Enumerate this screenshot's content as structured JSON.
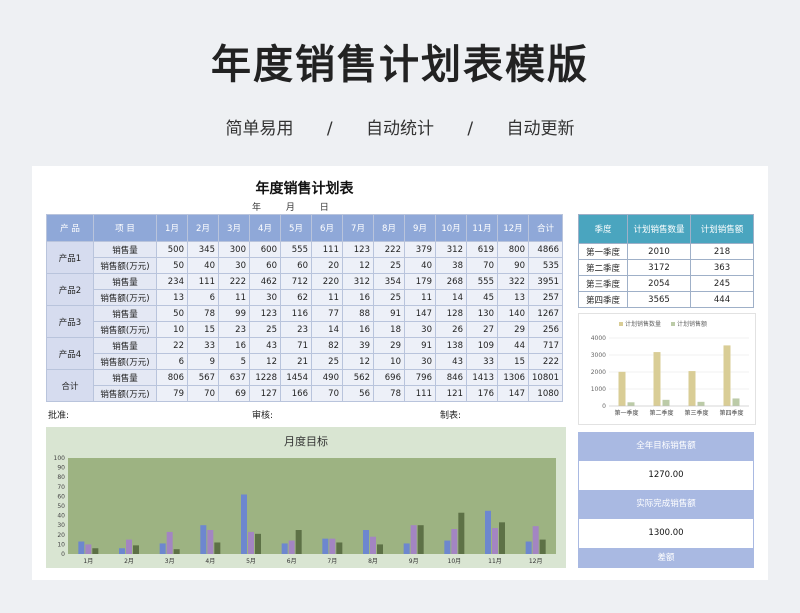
{
  "hero": {
    "title": "年度销售计划表模版",
    "subtitle": [
      "简单易用",
      "/",
      "自动统计",
      "/",
      "自动更新"
    ]
  },
  "sheet": {
    "title": "年度销售计划表",
    "date_labels": [
      "年",
      "月",
      "日"
    ],
    "headers": [
      "产  品",
      "项  目",
      "1月",
      "2月",
      "3月",
      "4月",
      "5月",
      "6月",
      "7月",
      "8月",
      "9月",
      "10月",
      "11月",
      "12月",
      "合计"
    ],
    "products": [
      {
        "name": "产品1",
        "rows": [
          {
            "metric": "销售量",
            "values": [
              "500",
              "345",
              "300",
              "600",
              "555",
              "111",
              "123",
              "222",
              "379",
              "312",
              "619",
              "800",
              "4866"
            ]
          },
          {
            "metric": "销售额(万元)",
            "values": [
              "50",
              "40",
              "30",
              "60",
              "60",
              "20",
              "12",
              "25",
              "40",
              "38",
              "70",
              "90",
              "535"
            ]
          }
        ]
      },
      {
        "name": "产品2",
        "rows": [
          {
            "metric": "销售量",
            "values": [
              "234",
              "111",
              "222",
              "462",
              "712",
              "220",
              "312",
              "354",
              "179",
              "268",
              "555",
              "322",
              "3951"
            ]
          },
          {
            "metric": "销售额(万元)",
            "values": [
              "13",
              "6",
              "11",
              "30",
              "62",
              "11",
              "16",
              "25",
              "11",
              "14",
              "45",
              "13",
              "257"
            ]
          }
        ]
      },
      {
        "name": "产品3",
        "rows": [
          {
            "metric": "销售量",
            "values": [
              "50",
              "78",
              "99",
              "123",
              "116",
              "77",
              "88",
              "91",
              "147",
              "128",
              "130",
              "140",
              "1267"
            ]
          },
          {
            "metric": "销售额(万元)",
            "values": [
              "10",
              "15",
              "23",
              "25",
              "23",
              "14",
              "16",
              "18",
              "30",
              "26",
              "27",
              "29",
              "256"
            ]
          }
        ]
      },
      {
        "name": "产品4",
        "rows": [
          {
            "metric": "销售量",
            "values": [
              "22",
              "33",
              "16",
              "43",
              "71",
              "82",
              "39",
              "29",
              "91",
              "138",
              "109",
              "44",
              "717"
            ]
          },
          {
            "metric": "销售额(万元)",
            "values": [
              "6",
              "9",
              "5",
              "12",
              "21",
              "25",
              "12",
              "10",
              "30",
              "43",
              "33",
              "15",
              "222"
            ]
          }
        ]
      },
      {
        "name": "合计",
        "rows": [
          {
            "metric": "销售量",
            "values": [
              "806",
              "567",
              "637",
              "1228",
              "1454",
              "490",
              "562",
              "696",
              "796",
              "846",
              "1413",
              "1306",
              "10801"
            ]
          },
          {
            "metric": "销售额(万元)",
            "values": [
              "79",
              "70",
              "69",
              "127",
              "166",
              "70",
              "56",
              "78",
              "111",
              "121",
              "176",
              "147",
              "1080"
            ]
          }
        ]
      }
    ],
    "sign": {
      "approve": "批准:",
      "review": "审核:",
      "prepare": "制表:"
    }
  },
  "quarter_table": {
    "headers": [
      "季度",
      "计划销售数量",
      "计划销售额"
    ],
    "rows": [
      [
        "第一季度",
        "2010",
        "218"
      ],
      [
        "第二季度",
        "3172",
        "363"
      ],
      [
        "第三季度",
        "2054",
        "245"
      ],
      [
        "第四季度",
        "3565",
        "444"
      ]
    ]
  },
  "target": {
    "annual_label": "全年目标销售额",
    "annual_value": "1270.00",
    "actual_label": "实际完成销售额",
    "actual_value": "1300.00",
    "diff_label": "差额"
  },
  "colors": {
    "header_blue": "#8fa8d8",
    "quarter_header": "#4aa5bf",
    "bar_gold": "#d9cd96",
    "bar_sage": "#bccba8",
    "monthly_bg": "#d9e5d2",
    "monthly_plot": "#9db382",
    "bar_blue": "#6d87cf",
    "bar_purple": "#a385c2",
    "bar_dark_green": "#5d7146"
  },
  "chart_data": [
    {
      "type": "bar",
      "title": "",
      "categories": [
        "第一季度",
        "第二季度",
        "第三季度",
        "第四季度"
      ],
      "series": [
        {
          "name": "计划销售数量",
          "values": [
            2010,
            3172,
            2054,
            3565
          ]
        },
        {
          "name": "计划销售额",
          "values": [
            218,
            363,
            245,
            444
          ]
        }
      ],
      "ylim": [
        0,
        4000
      ],
      "yticks": [
        0,
        1000,
        2000,
        3000,
        4000
      ],
      "legend": "top",
      "grid": true
    },
    {
      "type": "bar",
      "title": "月度目标",
      "categories": [
        "1月",
        "2月",
        "3月",
        "4月",
        "5月",
        "6月",
        "7月",
        "8月",
        "9月",
        "10月",
        "11月",
        "12月"
      ],
      "series": [
        {
          "values": [
            13,
            6,
            11,
            30,
            62,
            11,
            16,
            25,
            11,
            14,
            45,
            13
          ]
        },
        {
          "values": [
            10,
            15,
            23,
            25,
            23,
            14,
            16,
            18,
            30,
            26,
            27,
            29
          ]
        },
        {
          "values": [
            6,
            9,
            5,
            12,
            21,
            25,
            12,
            10,
            30,
            43,
            33,
            15
          ]
        }
      ],
      "ylim": [
        0,
        100
      ],
      "yticks": [
        0,
        10,
        20,
        30,
        40,
        50,
        60,
        70,
        80,
        90,
        100
      ],
      "grid": false
    }
  ]
}
